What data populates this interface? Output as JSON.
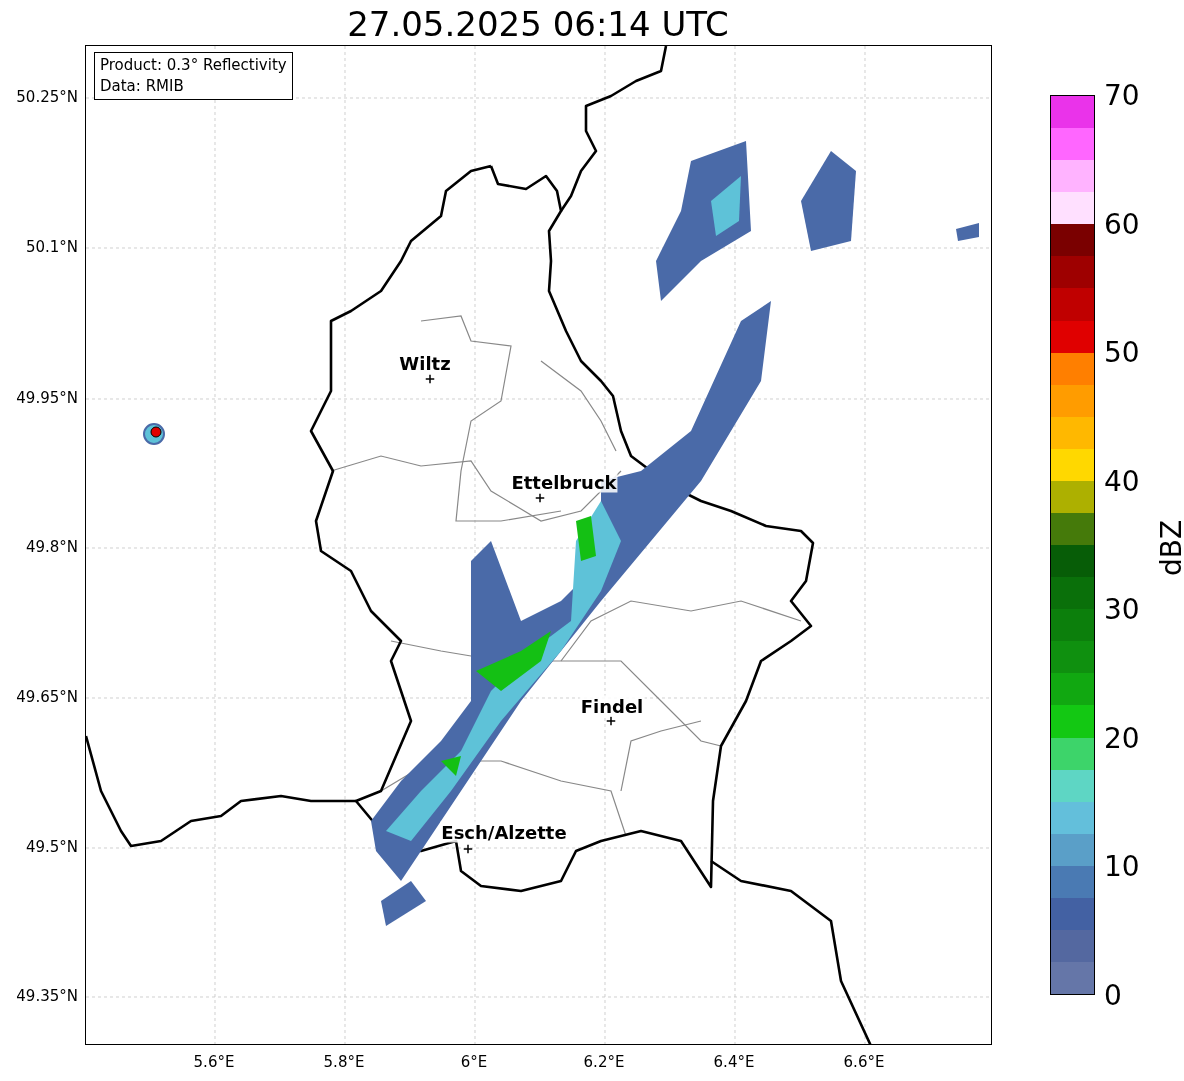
{
  "title": "27.05.2025 06:14 UTC",
  "info_box": [
    "Product: 0.3° Reflectivity",
    "Data: RMIB"
  ],
  "lat_ticks": [
    "50.25°N",
    "50.1°N",
    "49.95°N",
    "49.8°N",
    "49.65°N",
    "49.5°N",
    "49.35°N"
  ],
  "lon_ticks": [
    "5.6°E",
    "5.8°E",
    "6°E",
    "6.2°E",
    "6.4°E",
    "6.6°E"
  ],
  "cities": [
    {
      "name": "Wiltz"
    },
    {
      "name": "Ettelbruck"
    },
    {
      "name": "Findel"
    },
    {
      "name": "Esch/Alzette"
    }
  ],
  "colorbar": {
    "label": "dBZ",
    "ticks": [
      "70",
      "60",
      "50",
      "40",
      "30",
      "20",
      "10",
      "0"
    ],
    "bands": [
      {
        "color": "#ea33ea"
      },
      {
        "color": "#ff66ff"
      },
      {
        "color": "#ffb3ff"
      },
      {
        "color": "#ffe0ff"
      },
      {
        "color": "#7a0000"
      },
      {
        "color": "#9e0000"
      },
      {
        "color": "#c00000"
      },
      {
        "color": "#e00000"
      },
      {
        "color": "#ff7f00"
      },
      {
        "color": "#ff9c00"
      },
      {
        "color": "#ffb800"
      },
      {
        "color": "#ffd800"
      },
      {
        "color": "#adb000"
      },
      {
        "color": "#457a0a"
      },
      {
        "color": "#075d07"
      },
      {
        "color": "#0a700a"
      },
      {
        "color": "#0c7f0c"
      },
      {
        "color": "#0f900f"
      },
      {
        "color": "#11a811"
      },
      {
        "color": "#13c813"
      },
      {
        "color": "#3dd46a"
      },
      {
        "color": "#5ed6c4"
      },
      {
        "color": "#63bfdb"
      },
      {
        "color": "#5a9fc8"
      },
      {
        "color": "#4a7ab3"
      },
      {
        "color": "#4361a3"
      },
      {
        "color": "#5468a0"
      },
      {
        "color": "#6576a8"
      }
    ]
  }
}
